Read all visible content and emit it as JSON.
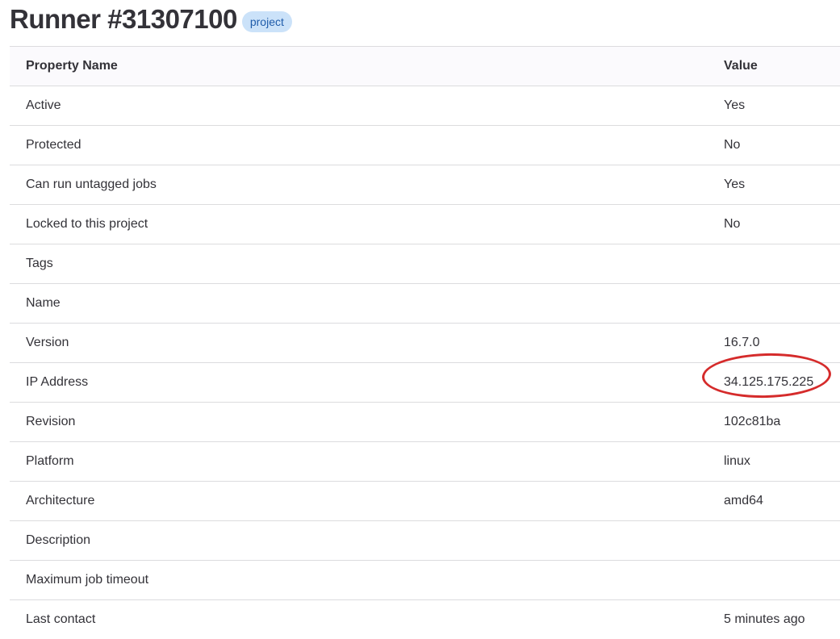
{
  "page": {
    "title": "Runner #31307100",
    "badge": "project"
  },
  "table": {
    "headers": {
      "name": "Property Name",
      "value": "Value"
    },
    "rows": [
      {
        "name": "Active",
        "value": "Yes"
      },
      {
        "name": "Protected",
        "value": "No"
      },
      {
        "name": "Can run untagged jobs",
        "value": "Yes"
      },
      {
        "name": "Locked to this project",
        "value": "No"
      },
      {
        "name": "Tags",
        "value": ""
      },
      {
        "name": "Name",
        "value": ""
      },
      {
        "name": "Version",
        "value": "16.7.0"
      },
      {
        "name": "IP Address",
        "value": "34.125.175.225"
      },
      {
        "name": "Revision",
        "value": "102c81ba"
      },
      {
        "name": "Platform",
        "value": "linux"
      },
      {
        "name": "Architecture",
        "value": "amd64"
      },
      {
        "name": "Description",
        "value": ""
      },
      {
        "name": "Maximum job timeout",
        "value": ""
      },
      {
        "name": "Last contact",
        "value": "5 minutes ago"
      }
    ]
  },
  "colors": {
    "badge_bg": "#cbe2f9",
    "badge_text": "#1f5caa",
    "annotation": "#d52b2b"
  }
}
